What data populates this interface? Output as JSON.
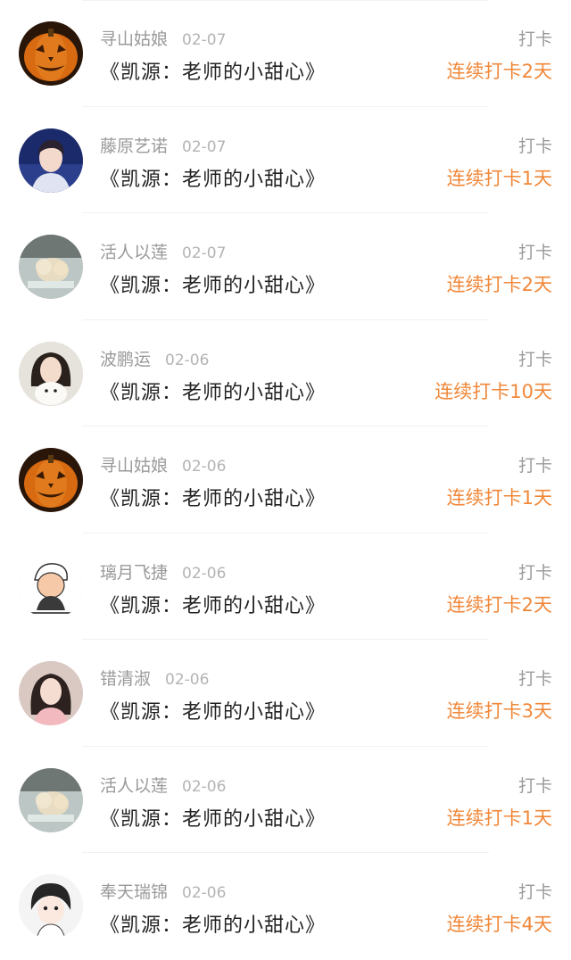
{
  "items": [
    {
      "name": "寻山姑娘",
      "date": "02-07",
      "title": "《凯源：老师的小甜心》",
      "action": "打卡",
      "streak": "连续打卡2天",
      "avatar": "pumpkin"
    },
    {
      "name": "藤原艺诺",
      "date": "02-07",
      "title": "《凯源：老师的小甜心》",
      "action": "打卡",
      "streak": "连续打卡1天",
      "avatar": "boy-blue"
    },
    {
      "name": "活人以莲",
      "date": "02-07",
      "title": "《凯源：老师的小甜心》",
      "action": "打卡",
      "streak": "连续打卡2天",
      "avatar": "girl-car"
    },
    {
      "name": "波鹏运",
      "date": "02-06",
      "title": "《凯源：老师的小甜心》",
      "action": "打卡",
      "streak": "连续打卡10天",
      "avatar": "girl-dog"
    },
    {
      "name": "寻山姑娘",
      "date": "02-06",
      "title": "《凯源：老师的小甜心》",
      "action": "打卡",
      "streak": "连续打卡1天",
      "avatar": "pumpkin"
    },
    {
      "name": "璃月飞捷",
      "date": "02-06",
      "title": "《凯源：老师的小甜心》",
      "action": "打卡",
      "streak": "连续打卡2天",
      "avatar": "cartoon"
    },
    {
      "name": "错清淑",
      "date": "02-06",
      "title": "《凯源：老师的小甜心》",
      "action": "打卡",
      "streak": "连续打卡3天",
      "avatar": "girl-pink"
    },
    {
      "name": "活人以莲",
      "date": "02-06",
      "title": "《凯源：老师的小甜心》",
      "action": "打卡",
      "streak": "连续打卡1天",
      "avatar": "girl-car"
    },
    {
      "name": "奉天瑞锦",
      "date": "02-06",
      "title": "《凯源：老师的小甜心》",
      "action": "打卡",
      "streak": "连续打卡4天",
      "avatar": "anime"
    }
  ],
  "colors": {
    "streak": "#f0883a",
    "name": "#9a9a9a",
    "title": "#222222"
  }
}
